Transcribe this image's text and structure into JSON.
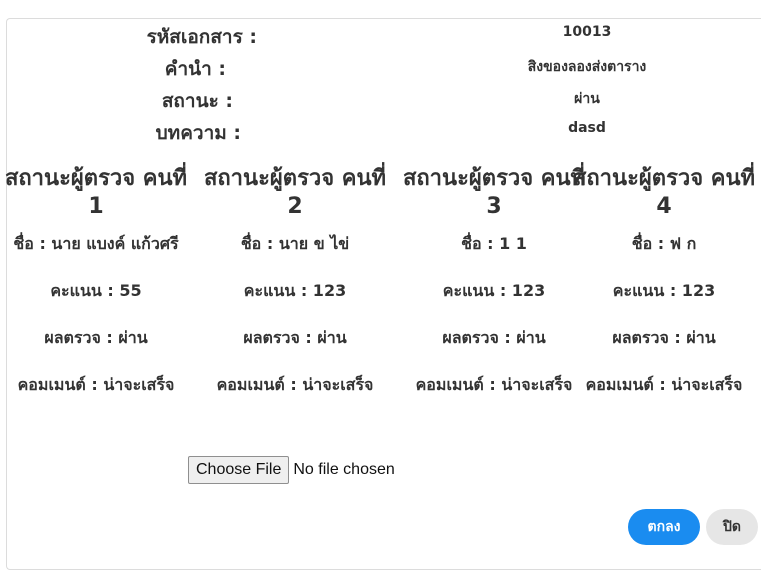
{
  "info": [
    {
      "label": "รหัสเอกสาร :",
      "value": "10013"
    },
    {
      "label": "คำนำ :",
      "value": "สิงของลองส่งตาราง"
    },
    {
      "label": "สถานะ :",
      "value": "ผ่าน"
    },
    {
      "label": "บทความ :",
      "value": "dasd"
    }
  ],
  "reviewers": [
    {
      "title": "สถานะผู้ตรวจ คนที่ 1",
      "name": "ชื่อ : นาย แบงค์ แก้วศรี",
      "score": "คะแนน : 55",
      "result": "ผลตรวจ : ผ่าน",
      "comment": "คอมเมนต์ : น่าจะเสร็จ"
    },
    {
      "title": "สถานะผู้ตรวจ คนที่ 2",
      "name": "ชื่อ : นาย ข ไข่",
      "score": "คะแนน : 123",
      "result": "ผลตรวจ : ผ่าน",
      "comment": "คอมเมนต์ : น่าจะเสร็จ"
    },
    {
      "title": "สถานะผู้ตรวจ คนที่ 3",
      "name": "ชื่อ : 1 1",
      "score": "คะแนน : 123",
      "result": "ผลตรวจ : ผ่าน",
      "comment": "คอมเมนต์ : น่าจะเสร็จ"
    },
    {
      "title": "สถานะผู้ตรวจ คนที่ 4",
      "name": "ชื่อ : ฟ ก",
      "score": "คะแนน : 123",
      "result": "ผลตรวจ : ผ่าน",
      "comment": "คอมเมนต์ : น่าจะเสร็จ"
    }
  ],
  "file_input": {
    "button_label": "Choose File",
    "status": "No file chosen"
  },
  "actions": {
    "ok_label": "ตกลง",
    "close_label": "ปิด"
  },
  "colors": {
    "primary": "#1a8cf0",
    "secondary": "#e6e6e6"
  }
}
